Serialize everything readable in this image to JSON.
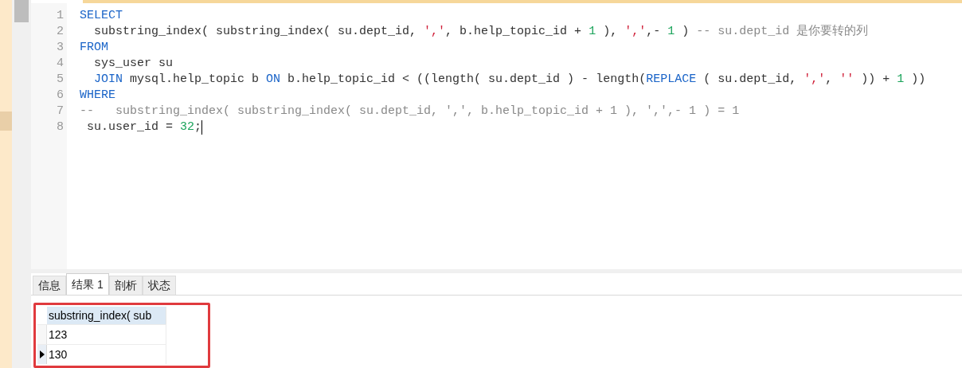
{
  "editor": {
    "lines": [
      {
        "number": "1",
        "tokens": [
          {
            "kind": "keyword",
            "text": "SELECT"
          }
        ]
      },
      {
        "number": "2",
        "tokens": [
          {
            "kind": "plain",
            "text": "  substring_index( substring_index( su.dept_id, "
          },
          {
            "kind": "string",
            "text": "','"
          },
          {
            "kind": "plain",
            "text": ", b.help_topic_id + "
          },
          {
            "kind": "number",
            "text": "1"
          },
          {
            "kind": "plain",
            "text": " ), "
          },
          {
            "kind": "string",
            "text": "','"
          },
          {
            "kind": "plain",
            "text": ",- "
          },
          {
            "kind": "number",
            "text": "1"
          },
          {
            "kind": "plain",
            "text": " ) "
          },
          {
            "kind": "comment",
            "text": "-- su.dept_id 是你要转的列"
          }
        ]
      },
      {
        "number": "3",
        "tokens": [
          {
            "kind": "keyword",
            "text": "FROM"
          }
        ]
      },
      {
        "number": "4",
        "tokens": [
          {
            "kind": "plain",
            "text": "  sys_user su"
          }
        ]
      },
      {
        "number": "5",
        "tokens": [
          {
            "kind": "keyword",
            "text": "  JOIN"
          },
          {
            "kind": "plain",
            "text": " mysql.help_topic b "
          },
          {
            "kind": "keyword",
            "text": "ON"
          },
          {
            "kind": "plain",
            "text": " b.help_topic_id < ((length( su.dept_id ) - length("
          },
          {
            "kind": "keyword",
            "text": "REPLACE"
          },
          {
            "kind": "plain",
            "text": " ( su.dept_id, "
          },
          {
            "kind": "string",
            "text": "','"
          },
          {
            "kind": "plain",
            "text": ", "
          },
          {
            "kind": "string",
            "text": "''"
          },
          {
            "kind": "plain",
            "text": " )) + "
          },
          {
            "kind": "number",
            "text": "1"
          },
          {
            "kind": "plain",
            "text": " ))"
          }
        ]
      },
      {
        "number": "6",
        "tokens": [
          {
            "kind": "keyword",
            "text": "WHERE"
          }
        ]
      },
      {
        "number": "7",
        "tokens": [
          {
            "kind": "comment",
            "text": "--   substring_index( substring_index( su.dept_id, ',', b.help_topic_id + 1 ), ',',- 1 ) = 1"
          }
        ]
      },
      {
        "number": "8",
        "tokens": [
          {
            "kind": "plain",
            "text": " su.user_id = "
          },
          {
            "kind": "number",
            "text": "32"
          },
          {
            "kind": "plain",
            "text": ";"
          }
        ],
        "cursor": true
      }
    ]
  },
  "tabs": [
    {
      "label": "信息",
      "selected": false
    },
    {
      "label": "结果 1",
      "selected": true
    },
    {
      "label": "剖析",
      "selected": false
    },
    {
      "label": "状态",
      "selected": false
    }
  ],
  "result_grid": {
    "columns": [
      "substring_index( sub"
    ],
    "rows": [
      {
        "cells": [
          "123"
        ],
        "selected": false
      },
      {
        "cells": [
          "130"
        ],
        "selected": true
      }
    ]
  }
}
